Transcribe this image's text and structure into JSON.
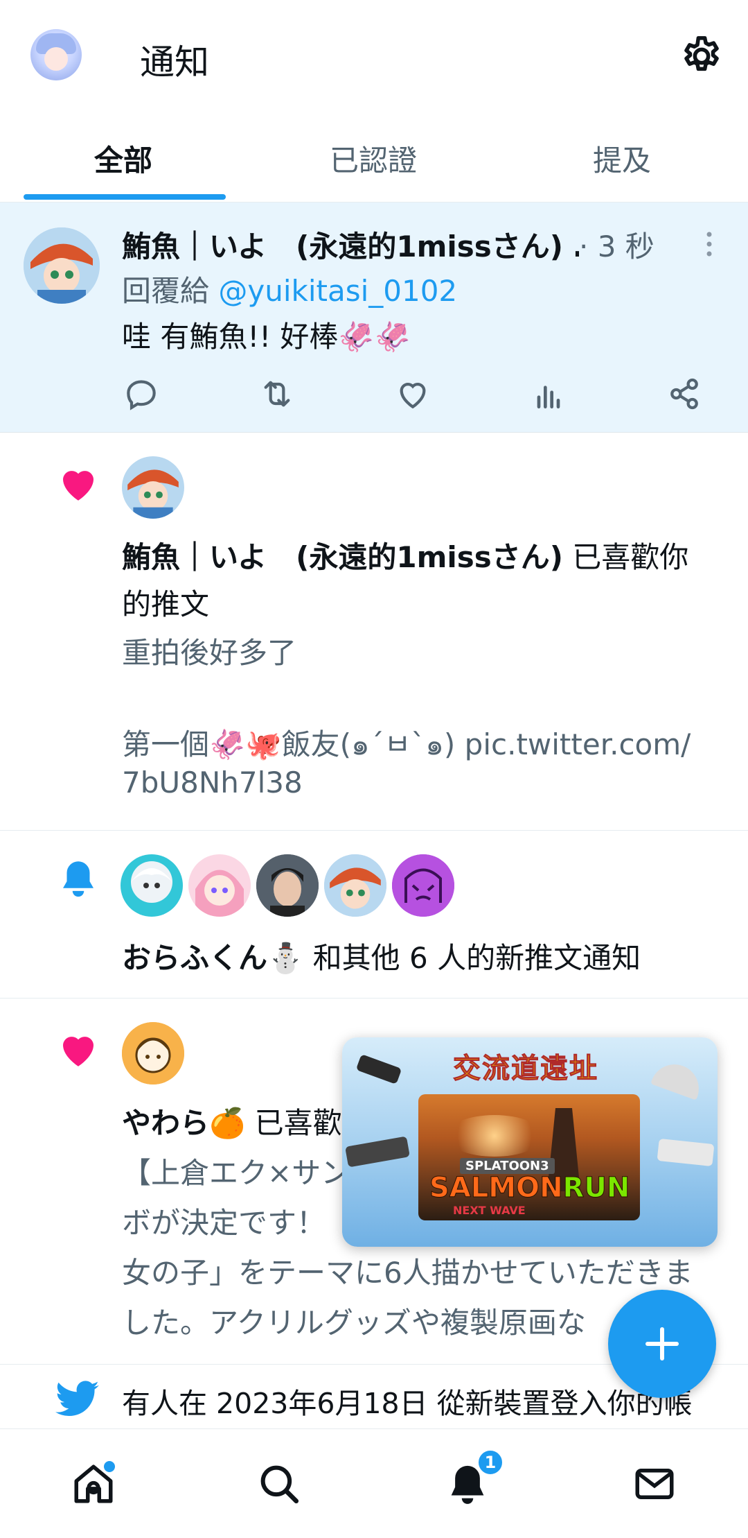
{
  "header": {
    "title": "通知",
    "settings_icon": "gear-icon"
  },
  "tabs": [
    {
      "label": "全部",
      "active": true
    },
    {
      "label": "已認證",
      "active": false
    },
    {
      "label": "提及",
      "active": false
    }
  ],
  "reply": {
    "name": "鮪魚｜いよ　(永遠的1missさん)",
    "ellipsis": "…",
    "time": "· 3 秒",
    "reply_prefix": "回覆給 ",
    "mention": "@yuikitasi_0102",
    "text": "哇 有鮪魚!! 好棒🦑🦑",
    "actions": [
      "reply-icon",
      "retweet-icon",
      "like-icon",
      "analytics-icon",
      "share-icon"
    ]
  },
  "like_notification_1": {
    "icon": "heart-icon",
    "actor": "鮪魚｜いよ　(永遠的1missさん)",
    "action_tail": " 已喜歡你",
    "action_line2": "的推文",
    "tweet_line1": "重拍後好多了",
    "tweet_line3": "第一個🦑🐙飯友(๑´ㅂ`๑) pic.twitter.com/",
    "tweet_line4": "7bU8Nh7l38"
  },
  "tweet_notification": {
    "icon": "bell-icon",
    "actor": "おらふくん⛄",
    "rest": " 和其他 6 人的新推文通知"
  },
  "like_notification_2": {
    "icon": "heart-icon",
    "actor": "やわら🍊",
    "action_tail": " 已喜歡",
    "tweet_line1": "【上倉エク×サン",
    "tweet_line2": "ボが決定です！",
    "tweet_line3": "女の子」をテーマに6人描かせていただきま",
    "tweet_line4": "した。アクリルグッズや複製原画な"
  },
  "login_notification": {
    "icon": "twitter-bird-icon",
    "text": "有人在 2023年6月18日 從新裝置登入你的帳"
  },
  "pip_video": {
    "title": "交流道遠址",
    "game_tag": "SPLATOON3",
    "logo_a": "SALMON",
    "logo_b": "RUN",
    "logo_sub": "NEXT WAVE"
  },
  "fab": {
    "icon": "plus-icon"
  },
  "bottom_nav": {
    "items": [
      "home-icon",
      "search-icon",
      "notifications-icon",
      "messages-icon"
    ],
    "notification_badge": "1"
  },
  "colors": {
    "accent": "#1d9bf0",
    "like": "#f91880",
    "reply_bg": "#e8f5fd"
  }
}
